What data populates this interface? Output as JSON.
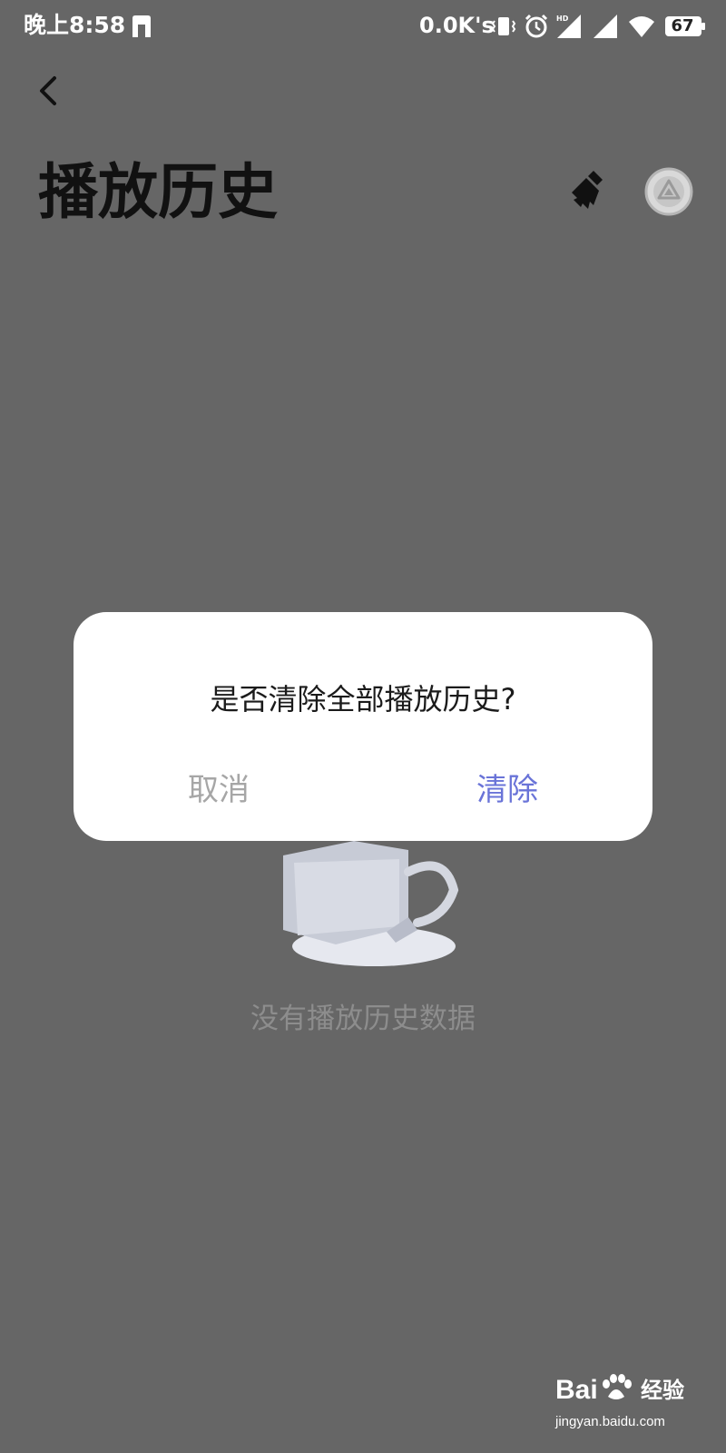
{
  "status_bar": {
    "time": "晚上8:58",
    "network_speed": "0.0K's",
    "battery": "67",
    "icons": [
      "notification-app-icon",
      "vibrate-icon",
      "alarm-icon",
      "hd-signal-icon",
      "signal-icon",
      "wifi-icon",
      "battery-icon"
    ]
  },
  "header": {
    "back_icon": "chevron-left-icon",
    "title": "播放历史",
    "clean_icon": "broom-icon",
    "mini_player_icon": "triangle-circle-icon"
  },
  "empty_state": {
    "message": "没有播放历史数据"
  },
  "dialog": {
    "message": "是否清除全部播放历史?",
    "cancel_label": "取消",
    "confirm_label": "清除",
    "confirm_color": "#6a74d8",
    "cancel_color": "#a6a6a6"
  },
  "watermark": {
    "brand": "Bai",
    "brand_cn": "经验",
    "domain": "jingyan.baidu.com"
  }
}
